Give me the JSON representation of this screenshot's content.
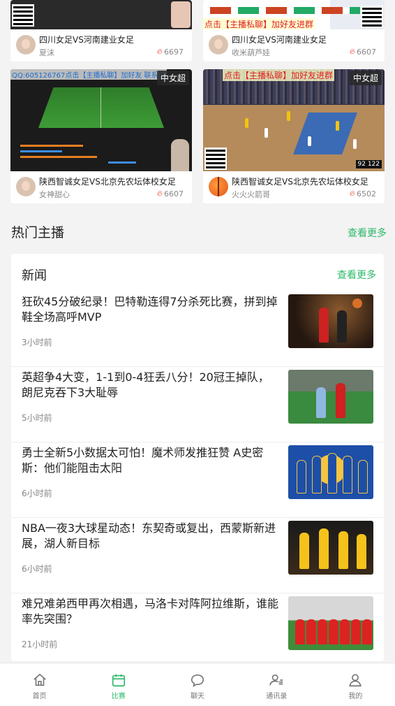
{
  "streams": [
    {
      "title": "四川女足VS河南建业女足",
      "host": "夏沫",
      "heat": "6697"
    },
    {
      "title": "四川女足VS河南建业女足",
      "host": "收米葫芦娃",
      "heat": "6607",
      "promo": "点击【主播私聊】加好友进群"
    },
    {
      "title": "陕西智诚女足VS北京先农坛体校女足",
      "host": "女神甜心",
      "heat": "6607",
      "badge": "中女超",
      "promo": "QQ:605126767点击【主播私聊】加好友 联系我"
    },
    {
      "title": "陕西智诚女足VS北京先农坛体校女足",
      "host": "火火火箭哥",
      "heat": "6502",
      "badge": "中女超",
      "promo": "点击【主播私聊】加好友进群",
      "score": "92 122"
    }
  ],
  "hot_anchors": {
    "title": "热门主播",
    "more": "查看更多"
  },
  "news": {
    "title": "新闻",
    "more": "查看更多",
    "items": [
      {
        "headline": "狂砍45分破纪录！巴特勒连得7分杀死比赛，拼到掉鞋全场高呼MVP",
        "time": "3小时前"
      },
      {
        "headline": "英超争4大变，1-1到0-4狂丢八分！20冠王掉队，朗尼克吞下3大耻辱",
        "time": "5小时前"
      },
      {
        "headline": "勇士全新5小数据太可怕！魔术师发推狂赞 A史密斯：他们能阻击太阳",
        "time": "6小时前"
      },
      {
        "headline": "NBA一夜3大球星动态！东契奇或复出，西蒙斯新进展，湖人新目标",
        "time": "6小时前"
      },
      {
        "headline": "难兄难弟西甲再次相遇，马洛卡对阵阿拉维斯，谁能率先突围？",
        "time": "21小时前"
      }
    ]
  },
  "tabbar": [
    {
      "label": "首页",
      "icon": "home-icon"
    },
    {
      "label": "比赛",
      "icon": "calendar-icon"
    },
    {
      "label": "聊天",
      "icon": "chat-bubble-icon"
    },
    {
      "label": "通讯录",
      "icon": "contacts-icon"
    },
    {
      "label": "我的",
      "icon": "user-icon"
    }
  ],
  "colors": {
    "accent": "#2db86a",
    "flame": "#e93a2b"
  }
}
